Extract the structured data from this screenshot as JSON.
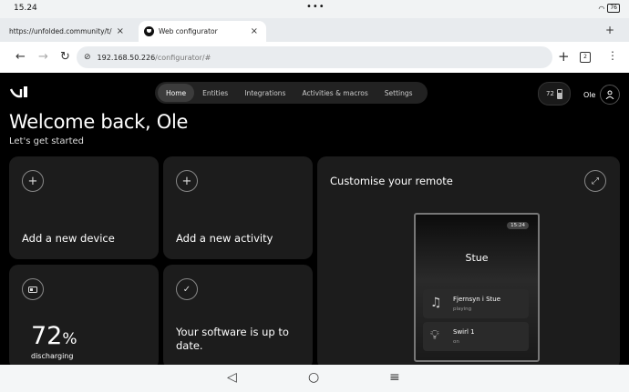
{
  "statusbar": {
    "time": "15.24",
    "dots": "•••",
    "battery": "76"
  },
  "tabs": [
    {
      "label": "https://unfolded.community/t/"
    },
    {
      "label": "Web configurator"
    }
  ],
  "address": {
    "host": "192.168.50.226",
    "path": "/configurator/#",
    "tab_count": "2"
  },
  "app": {
    "nav": [
      "Home",
      "Entities",
      "Integrations",
      "Activities & macros",
      "Settings"
    ],
    "battery_level": "72",
    "user": "Ole",
    "welcome": "Welcome back, Ole",
    "subtitle": "Let's get started"
  },
  "cards": {
    "add_device": "Add a new device",
    "add_activity": "Add a new activity",
    "battery_percent": "72",
    "battery_unit": "%",
    "battery_status": "discharging",
    "software_line1": "Your software is up to",
    "software_line2": "date.",
    "customise": "Customise your remote"
  },
  "phone": {
    "clock": "15:24",
    "room": "Stue",
    "rows": [
      {
        "title": "Fjernsyn i Stue",
        "state": "playing"
      },
      {
        "title": "Swirl 1",
        "state": "on"
      }
    ]
  }
}
